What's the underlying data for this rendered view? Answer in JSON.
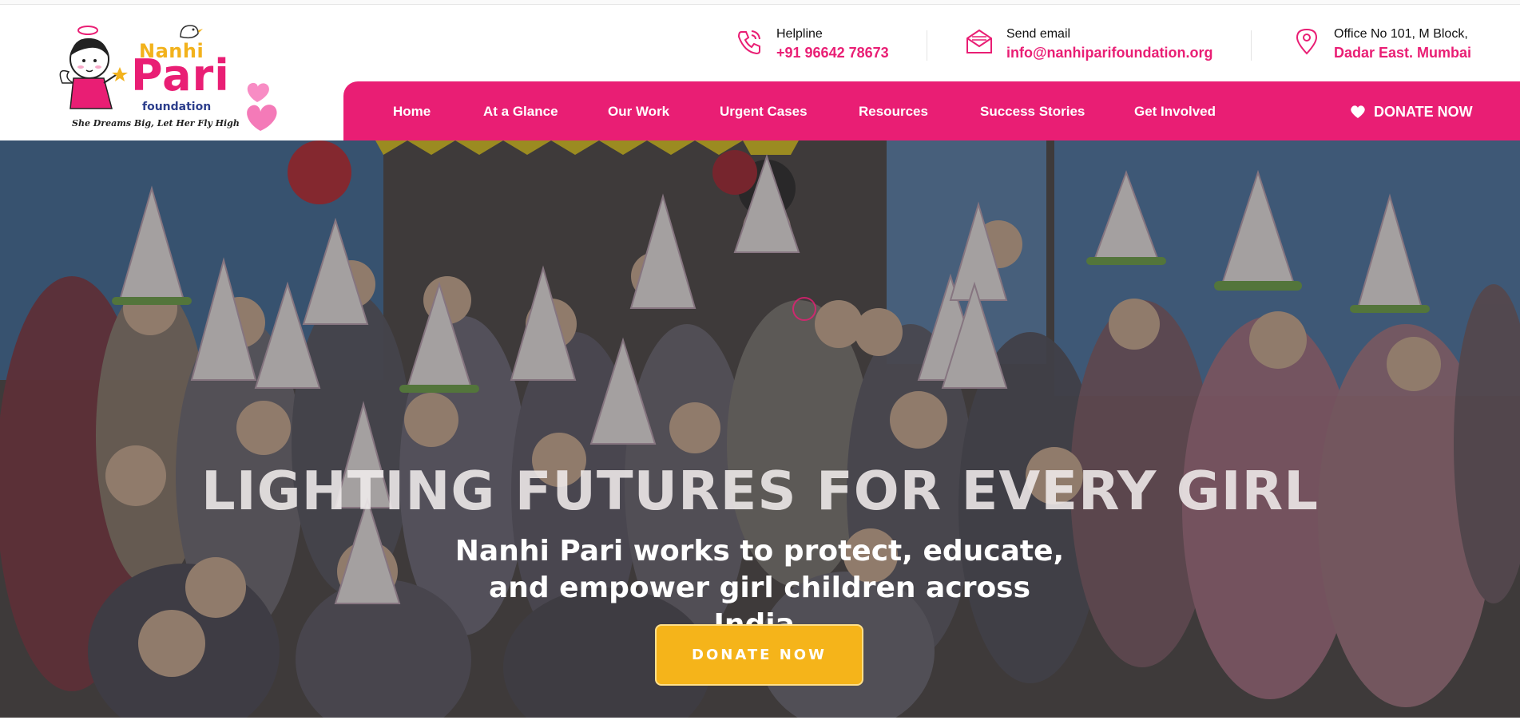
{
  "logo": {
    "nanhi": "Nanhi",
    "pari": "Pari",
    "foundation": "foundation",
    "tagline": "She Dreams Big, Let Her Fly High"
  },
  "contacts": [
    {
      "icon": "phone-icon",
      "label": "Helpline",
      "value": "+91 96642 78673"
    },
    {
      "icon": "email-icon",
      "label": "Send email",
      "value": "info@nanhiparifoundation.org"
    },
    {
      "icon": "location-icon",
      "label": "Office No 101, M Block,",
      "value": "Dadar East. Mumbai"
    }
  ],
  "nav": {
    "items": [
      "Home",
      "At a Glance",
      "Our Work",
      "Urgent Cases",
      "Resources",
      "Success Stories",
      "Get Involved"
    ],
    "donate_label": "DONATE NOW"
  },
  "hero": {
    "title": "LIGHTING FUTURES FOR EVERY GIRL",
    "subtitle": "Nanhi Pari works to protect, educate, and empower girl children across India.",
    "button_label": "DONATE NOW"
  },
  "colors": {
    "brand_pink": "#e91e74",
    "accent_yellow": "#f5b41a",
    "logo_navy": "#2c3e8c"
  }
}
